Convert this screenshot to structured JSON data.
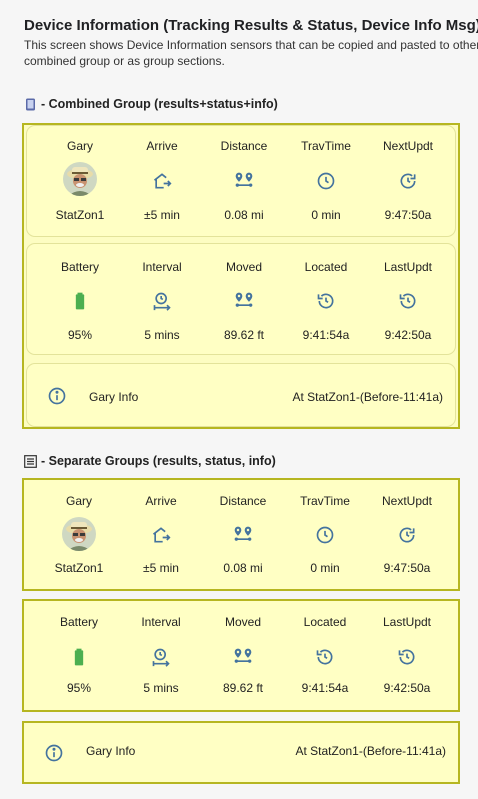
{
  "page": {
    "title": "Device Information (Tracking Results & Status, Device Info Msg)",
    "description_line1": "This screen shows Device Information sensors that can be copied and pasted to other",
    "description_line2": "combined group or as group sections."
  },
  "sections": {
    "combined_title": "- Combined Group (results+status+info)",
    "separate_title": "- Separate Groups (results, status, info)"
  },
  "results": {
    "person": {
      "label": "Gary",
      "value": "StatZon1"
    },
    "arrive": {
      "label": "Arrive",
      "value": "±5 min",
      "icon": "home-export-icon"
    },
    "distance": {
      "label": "Distance",
      "value": "0.08 mi",
      "icon": "map-marker-distance-icon"
    },
    "travtime": {
      "label": "TravTime",
      "value": "0 min",
      "icon": "clock-outline-icon"
    },
    "nextupdt": {
      "label": "NextUpdt",
      "value": "9:47:50a",
      "icon": "update-icon"
    }
  },
  "status": {
    "battery": {
      "label": "Battery",
      "value": "95%",
      "icon": "battery-icon",
      "color": "#4caf50"
    },
    "interval": {
      "label": "Interval",
      "value": "5 mins",
      "icon": "timer-interval-icon"
    },
    "moved": {
      "label": "Moved",
      "value": "89.62 ft",
      "icon": "map-marker-distance-icon"
    },
    "located": {
      "label": "Located",
      "value": "9:41:54a",
      "icon": "history-icon"
    },
    "lastupdt": {
      "label": "LastUpdt",
      "value": "9:42:50a",
      "icon": "history-icon"
    }
  },
  "info": {
    "name": "Gary Info",
    "state": "At StatZon1-(Before-11:41a)",
    "icon": "information-outline-icon"
  },
  "colors": {
    "card_background": "#ffffc4",
    "card_border": "#b6b621",
    "icon_color": "#44739e",
    "battery_color": "#4caf50"
  }
}
